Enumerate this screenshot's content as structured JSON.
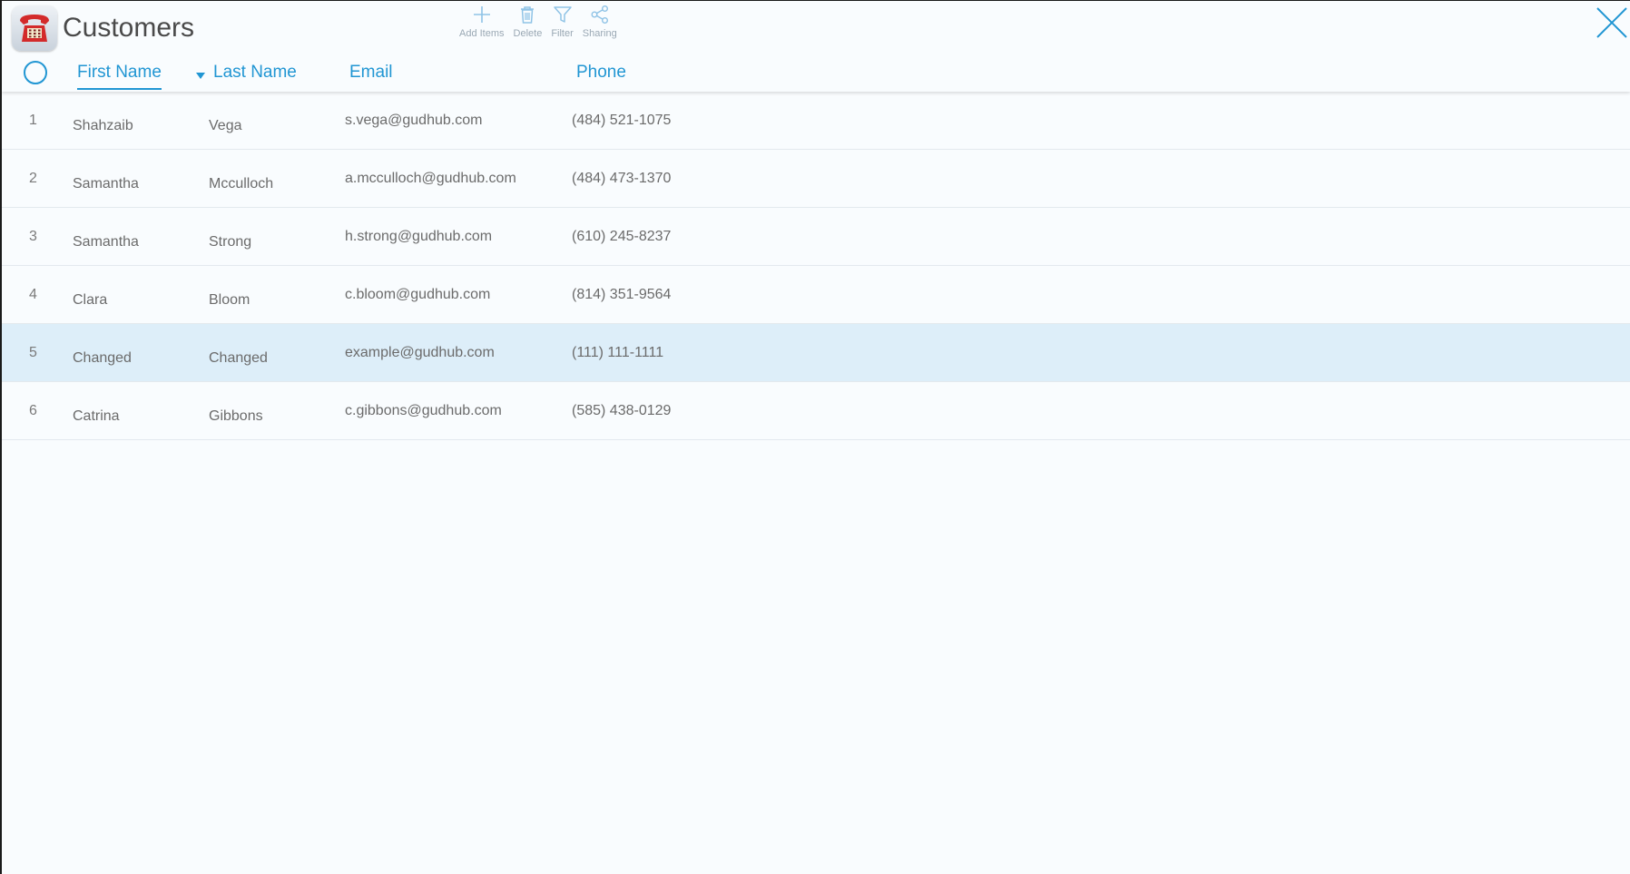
{
  "window": {
    "title": "Customers",
    "app_icon": "telephone-icon"
  },
  "toolbar": {
    "items": [
      {
        "label": "Add Items",
        "icon": "plus-icon"
      },
      {
        "label": "Delete",
        "icon": "trash-icon"
      },
      {
        "label": "Filter",
        "icon": "filter-icon"
      },
      {
        "label": "Sharing",
        "icon": "share-icon"
      }
    ]
  },
  "table": {
    "columns": [
      "First Name",
      "Last Name",
      "Email",
      "Phone"
    ],
    "sorted_column": "First Name",
    "rows": [
      {
        "num": "1",
        "first": "Shahzaib",
        "last": "Vega",
        "email": "s.vega@gudhub.com",
        "phone": "(484) 521-1075"
      },
      {
        "num": "2",
        "first": "Samantha",
        "last": "Mcculloch",
        "email": "a.mcculloch@gudhub.com",
        "phone": "(484) 473-1370"
      },
      {
        "num": "3",
        "first": "Samantha",
        "last": "Strong",
        "email": "h.strong@gudhub.com",
        "phone": "(610) 245-8237"
      },
      {
        "num": "4",
        "first": "Clara",
        "last": "Bloom",
        "email": "c.bloom@gudhub.com",
        "phone": "(814) 351-9564"
      },
      {
        "num": "5",
        "first": "Changed",
        "last": "Changed",
        "email": "example@gudhub.com",
        "phone": "(111) 111-1111"
      },
      {
        "num": "6",
        "first": "Catrina",
        "last": "Gibbons",
        "email": "c.gibbons@gudhub.com",
        "phone": "(585) 438-0129"
      }
    ],
    "selected_row": 4
  },
  "colors": {
    "accent": "#2196d3",
    "selected_row_bg": "#ddeef9",
    "background": "#f9fcfe"
  }
}
